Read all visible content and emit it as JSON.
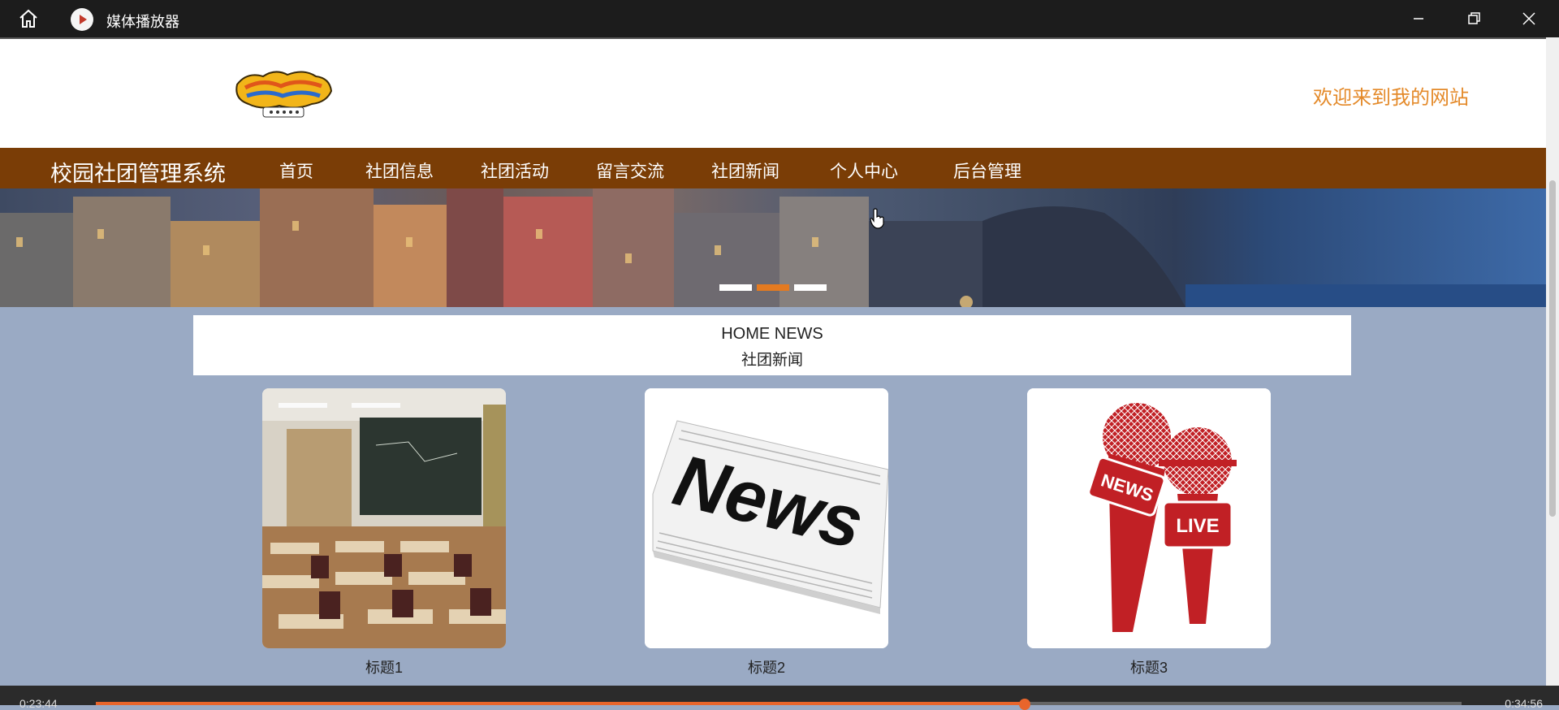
{
  "window": {
    "title": "媒体播放器"
  },
  "site": {
    "welcome": "欢迎来到我的网站",
    "brand": "校园社团管理系统",
    "nav": [
      "首页",
      "社团信息",
      "社团活动",
      "留言交流",
      "社团新闻",
      "个人中心",
      "后台管理"
    ],
    "slider": {
      "count": 3,
      "active_index": 1
    }
  },
  "news": {
    "heading_en": "HOME NEWS",
    "heading_zh": "社团新闻",
    "items": [
      {
        "caption": "标题1",
        "image": "classroom"
      },
      {
        "caption": "标题2",
        "image": "newspaper",
        "text": "News"
      },
      {
        "caption": "标题3",
        "image": "microphones",
        "badge_news": "NEWS",
        "badge_live": "LIVE"
      }
    ]
  },
  "player": {
    "elapsed": "0:23:44",
    "total": "0:34:56",
    "progress": 0.68
  },
  "colors": {
    "nav_bg": "#7a3d06",
    "accent": "#e48a2a",
    "page_bg": "#9aaac4"
  }
}
